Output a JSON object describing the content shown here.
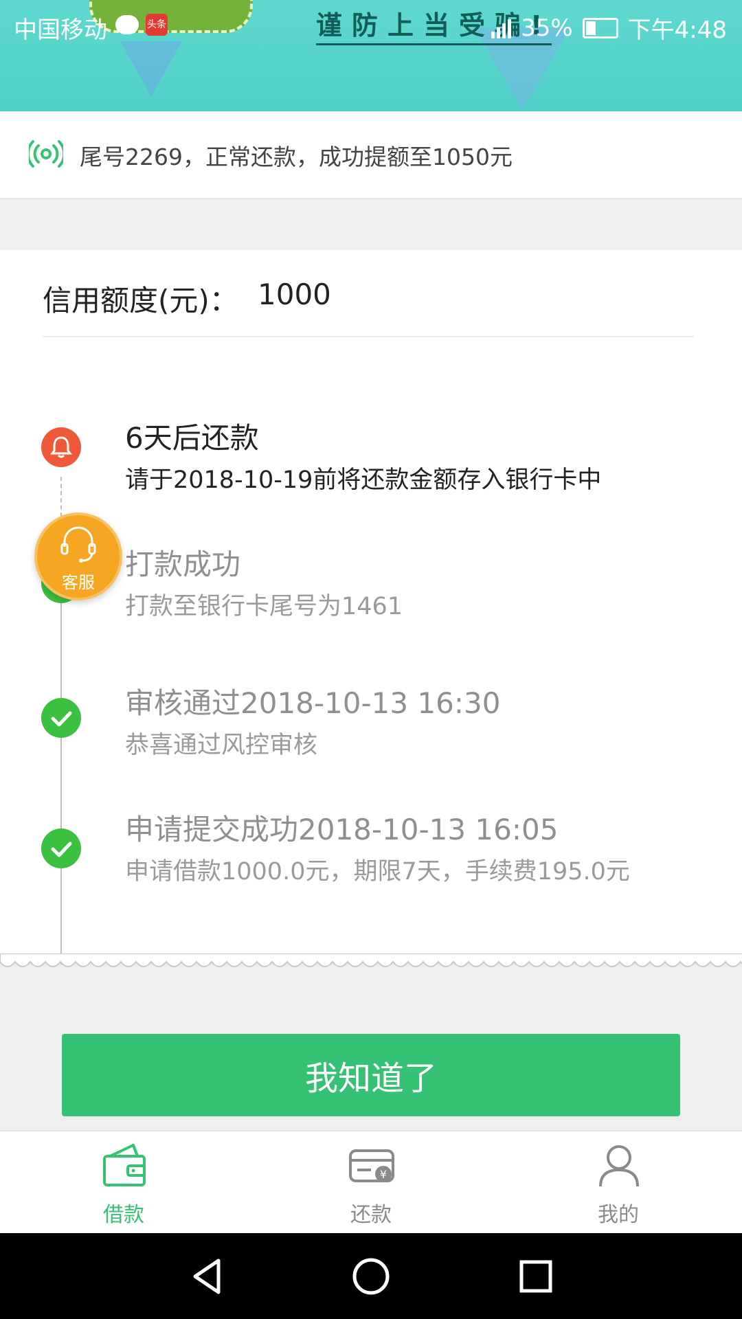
{
  "status_bar": {
    "carrier": "中国移动",
    "battery": "35%",
    "time": "下午4:48",
    "news_badge": "头条"
  },
  "banner": {
    "slogan": "谨防上当受骗!"
  },
  "notice": {
    "text": "尾号2269，正常还款，成功提额至1050元",
    "icon": "broadcast-icon"
  },
  "credit": {
    "label": "信用额度(元)：",
    "value": "1000"
  },
  "timeline": [
    {
      "title": "6天后还款",
      "desc": "请于2018-10-19前将还款金额存入银行卡中",
      "icon": "bell-icon",
      "state": "active"
    },
    {
      "title": "打款成功",
      "desc": "打款至银行卡尾号为1461",
      "icon": "check-icon",
      "state": "done"
    },
    {
      "title": "审核通过2018-10-13 16:30",
      "desc": "恭喜通过风控审核",
      "icon": "check-icon",
      "state": "done"
    },
    {
      "title": "申请提交成功2018-10-13 16:05",
      "desc": "申请借款1000.0元，期限7天，手续费195.0元",
      "icon": "check-icon",
      "state": "done"
    }
  ],
  "customer_service": {
    "label": "客服",
    "icon": "headset-icon"
  },
  "confirm_button": {
    "label": "我知道了"
  },
  "tabs": [
    {
      "label": "借款",
      "icon": "wallet-icon",
      "active": true
    },
    {
      "label": "还款",
      "icon": "card-yen-icon",
      "active": false
    },
    {
      "label": "我的",
      "icon": "user-icon",
      "active": false
    }
  ],
  "colors": {
    "accent": "#36c275",
    "bell": "#f0583a",
    "check": "#3cc040",
    "service": "#f5a623",
    "banner": "#4fd0c6"
  }
}
